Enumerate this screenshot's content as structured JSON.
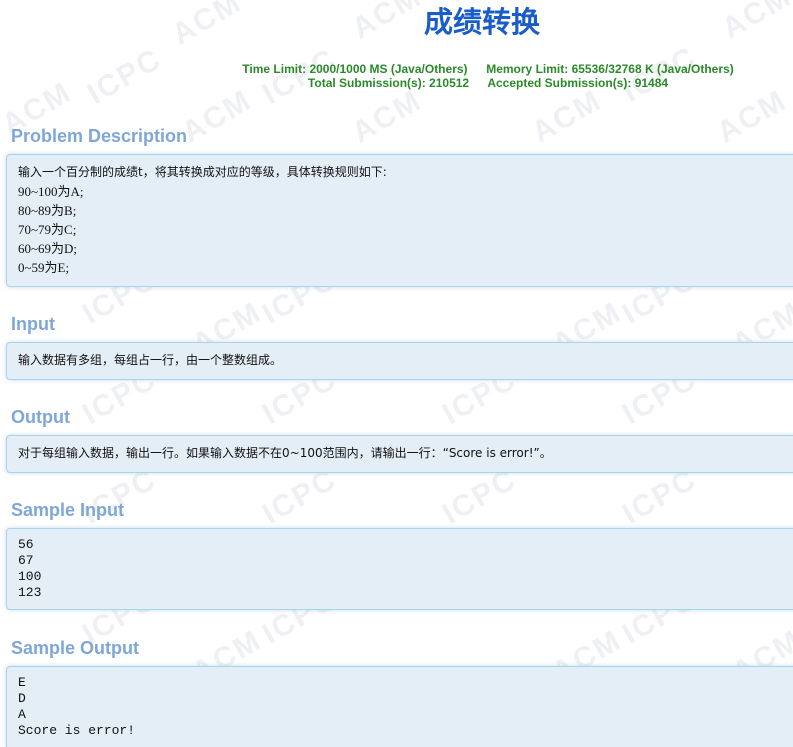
{
  "problem": {
    "title": "成绩转换",
    "limits": {
      "time_label": "Time Limit:",
      "time_value": "2000/1000 MS (Java/Others)",
      "memory_label": "Memory Limit:",
      "memory_value": "65536/32768 K (Java/Others)",
      "total_label": "Total Submission(s):",
      "total_value": "210512",
      "accepted_label": "Accepted Submission(s):",
      "accepted_value": "91484"
    }
  },
  "watermark": {
    "text_acm": "ACM",
    "text_icpc": "ICPC"
  },
  "sections": {
    "description": {
      "heading": "Problem Description",
      "lines": [
        "输入一个百分制的成绩t，将其转换成对应的等级，具体转换规则如下:",
        "90~100为A;",
        "80~89为B;",
        "70~79为C;",
        "60~69为D;",
        "0~59为E;"
      ]
    },
    "input": {
      "heading": "Input",
      "lines": [
        "输入数据有多组，每组占一行，由一个整数组成。"
      ]
    },
    "output": {
      "heading": "Output",
      "lines": [
        "对于每组输入数据，输出一行。如果输入数据不在0~100范围内，请输出一行：“Score is error!”。"
      ]
    },
    "sample_input": {
      "heading": "Sample Input",
      "lines": [
        "56",
        "67",
        "100",
        "123"
      ]
    },
    "sample_output": {
      "heading": "Sample Output",
      "lines": [
        "E",
        "D",
        "A",
        "Score is error!"
      ]
    }
  }
}
